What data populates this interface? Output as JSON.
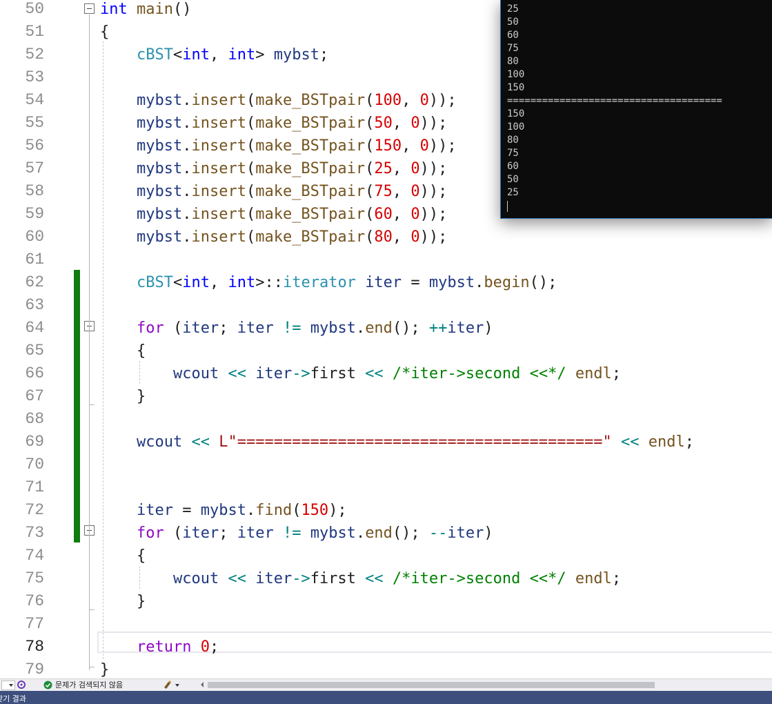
{
  "editor": {
    "line_numbers": [
      "50",
      "51",
      "52",
      "53",
      "54",
      "55",
      "56",
      "57",
      "58",
      "59",
      "60",
      "61",
      "62",
      "63",
      "64",
      "65",
      "66",
      "67",
      "68",
      "69",
      "70",
      "71",
      "72",
      "73",
      "74",
      "75",
      "76",
      "77",
      "78",
      "79"
    ],
    "current_line": "78",
    "lines": [
      [
        [
          "kw",
          "int"
        ],
        [
          "pun",
          " "
        ],
        [
          "fn",
          "main"
        ],
        [
          "pun",
          "()"
        ]
      ],
      [
        [
          "pun",
          "{"
        ]
      ],
      [
        [
          "pun",
          "    "
        ],
        [
          "cls",
          "cBST"
        ],
        [
          "pun",
          "<"
        ],
        [
          "kw",
          "int"
        ],
        [
          "pun",
          ", "
        ],
        [
          "kw",
          "int"
        ],
        [
          "pun",
          "> "
        ],
        [
          "var",
          "mybst"
        ],
        [
          "pun",
          ";"
        ]
      ],
      [],
      [
        [
          "pun",
          "    "
        ],
        [
          "var",
          "mybst"
        ],
        [
          "pun",
          "."
        ],
        [
          "fn",
          "insert"
        ],
        [
          "pun",
          "("
        ],
        [
          "fn",
          "make_BSTpair"
        ],
        [
          "pun",
          "("
        ],
        [
          "num",
          "100"
        ],
        [
          "pun",
          ", "
        ],
        [
          "num",
          "0"
        ],
        [
          "pun",
          "));"
        ]
      ],
      [
        [
          "pun",
          "    "
        ],
        [
          "var",
          "mybst"
        ],
        [
          "pun",
          "."
        ],
        [
          "fn",
          "insert"
        ],
        [
          "pun",
          "("
        ],
        [
          "fn",
          "make_BSTpair"
        ],
        [
          "pun",
          "("
        ],
        [
          "num",
          "50"
        ],
        [
          "pun",
          ", "
        ],
        [
          "num",
          "0"
        ],
        [
          "pun",
          "));"
        ]
      ],
      [
        [
          "pun",
          "    "
        ],
        [
          "var",
          "mybst"
        ],
        [
          "pun",
          "."
        ],
        [
          "fn",
          "insert"
        ],
        [
          "pun",
          "("
        ],
        [
          "fn",
          "make_BSTpair"
        ],
        [
          "pun",
          "("
        ],
        [
          "num",
          "150"
        ],
        [
          "pun",
          ", "
        ],
        [
          "num",
          "0"
        ],
        [
          "pun",
          "));"
        ]
      ],
      [
        [
          "pun",
          "    "
        ],
        [
          "var",
          "mybst"
        ],
        [
          "pun",
          "."
        ],
        [
          "fn",
          "insert"
        ],
        [
          "pun",
          "("
        ],
        [
          "fn",
          "make_BSTpair"
        ],
        [
          "pun",
          "("
        ],
        [
          "num",
          "25"
        ],
        [
          "pun",
          ", "
        ],
        [
          "num",
          "0"
        ],
        [
          "pun",
          "));"
        ]
      ],
      [
        [
          "pun",
          "    "
        ],
        [
          "var",
          "mybst"
        ],
        [
          "pun",
          "."
        ],
        [
          "fn",
          "insert"
        ],
        [
          "pun",
          "("
        ],
        [
          "fn",
          "make_BSTpair"
        ],
        [
          "pun",
          "("
        ],
        [
          "num",
          "75"
        ],
        [
          "pun",
          ", "
        ],
        [
          "num",
          "0"
        ],
        [
          "pun",
          "));"
        ]
      ],
      [
        [
          "pun",
          "    "
        ],
        [
          "var",
          "mybst"
        ],
        [
          "pun",
          "."
        ],
        [
          "fn",
          "insert"
        ],
        [
          "pun",
          "("
        ],
        [
          "fn",
          "make_BSTpair"
        ],
        [
          "pun",
          "("
        ],
        [
          "num",
          "60"
        ],
        [
          "pun",
          ", "
        ],
        [
          "num",
          "0"
        ],
        [
          "pun",
          "));"
        ]
      ],
      [
        [
          "pun",
          "    "
        ],
        [
          "var",
          "mybst"
        ],
        [
          "pun",
          "."
        ],
        [
          "fn",
          "insert"
        ],
        [
          "pun",
          "("
        ],
        [
          "fn",
          "make_BSTpair"
        ],
        [
          "pun",
          "("
        ],
        [
          "num",
          "80"
        ],
        [
          "pun",
          ", "
        ],
        [
          "num",
          "0"
        ],
        [
          "pun",
          "));"
        ]
      ],
      [],
      [
        [
          "pun",
          "    "
        ],
        [
          "cls",
          "cBST"
        ],
        [
          "pun",
          "<"
        ],
        [
          "kw",
          "int"
        ],
        [
          "pun",
          ", "
        ],
        [
          "kw",
          "int"
        ],
        [
          "pun",
          ">::"
        ],
        [
          "cls",
          "iterator"
        ],
        [
          "pun",
          " "
        ],
        [
          "var",
          "iter"
        ],
        [
          "pun",
          " = "
        ],
        [
          "var",
          "mybst"
        ],
        [
          "pun",
          "."
        ],
        [
          "fn",
          "begin"
        ],
        [
          "pun",
          "();"
        ]
      ],
      [],
      [
        [
          "pun",
          "    "
        ],
        [
          "ctl",
          "for"
        ],
        [
          "pun",
          " ("
        ],
        [
          "var",
          "iter"
        ],
        [
          "pun",
          "; "
        ],
        [
          "var",
          "iter"
        ],
        [
          "pun",
          " "
        ],
        [
          "op",
          "!="
        ],
        [
          "pun",
          " "
        ],
        [
          "var",
          "mybst"
        ],
        [
          "pun",
          "."
        ],
        [
          "fn",
          "end"
        ],
        [
          "pun",
          "(); "
        ],
        [
          "op",
          "++"
        ],
        [
          "var",
          "iter"
        ],
        [
          "pun",
          ")"
        ]
      ],
      [
        [
          "pun",
          "    {"
        ]
      ],
      [
        [
          "pun",
          "        "
        ],
        [
          "var",
          "wcout"
        ],
        [
          "pun",
          " "
        ],
        [
          "op",
          "<<"
        ],
        [
          "pun",
          " "
        ],
        [
          "var",
          "iter"
        ],
        [
          "op",
          "->"
        ],
        [
          "pun",
          "first "
        ],
        [
          "op",
          "<<"
        ],
        [
          "pun",
          " "
        ],
        [
          "cmt",
          "/*iter->second <<*/"
        ],
        [
          "pun",
          " "
        ],
        [
          "fn",
          "endl"
        ],
        [
          "pun",
          ";"
        ]
      ],
      [
        [
          "pun",
          "    }"
        ]
      ],
      [],
      [
        [
          "pun",
          "    "
        ],
        [
          "var",
          "wcout"
        ],
        [
          "pun",
          " "
        ],
        [
          "op",
          "<<"
        ],
        [
          "pun",
          " "
        ],
        [
          "str",
          "L\"========================================\""
        ],
        [
          "pun",
          " "
        ],
        [
          "op",
          "<<"
        ],
        [
          "pun",
          " "
        ],
        [
          "fn",
          "endl"
        ],
        [
          "pun",
          ";"
        ]
      ],
      [],
      [],
      [
        [
          "pun",
          "    "
        ],
        [
          "var",
          "iter"
        ],
        [
          "pun",
          " = "
        ],
        [
          "var",
          "mybst"
        ],
        [
          "pun",
          "."
        ],
        [
          "fn",
          "find"
        ],
        [
          "pun",
          "("
        ],
        [
          "num",
          "150"
        ],
        [
          "pun",
          ");"
        ]
      ],
      [
        [
          "pun",
          "    "
        ],
        [
          "ctl",
          "for"
        ],
        [
          "pun",
          " ("
        ],
        [
          "var",
          "iter"
        ],
        [
          "pun",
          "; "
        ],
        [
          "var",
          "iter"
        ],
        [
          "pun",
          " "
        ],
        [
          "op",
          "!="
        ],
        [
          "pun",
          " "
        ],
        [
          "var",
          "mybst"
        ],
        [
          "pun",
          "."
        ],
        [
          "fn",
          "end"
        ],
        [
          "pun",
          "(); "
        ],
        [
          "op",
          "--"
        ],
        [
          "var",
          "iter"
        ],
        [
          "pun",
          ")"
        ]
      ],
      [
        [
          "pun",
          "    {"
        ]
      ],
      [
        [
          "pun",
          "        "
        ],
        [
          "var",
          "wcout"
        ],
        [
          "pun",
          " "
        ],
        [
          "op",
          "<<"
        ],
        [
          "pun",
          " "
        ],
        [
          "var",
          "iter"
        ],
        [
          "op",
          "->"
        ],
        [
          "pun",
          "first "
        ],
        [
          "op",
          "<<"
        ],
        [
          "pun",
          " "
        ],
        [
          "cmt",
          "/*iter->second <<*/"
        ],
        [
          "pun",
          " "
        ],
        [
          "fn",
          "endl"
        ],
        [
          "pun",
          ";"
        ]
      ],
      [
        [
          "pun",
          "    }"
        ]
      ],
      [],
      [
        [
          "pun",
          "    "
        ],
        [
          "ctl",
          "return"
        ],
        [
          "pun",
          " "
        ],
        [
          "num",
          "0"
        ],
        [
          "pun",
          ";"
        ]
      ],
      [
        [
          "pun",
          "}"
        ]
      ]
    ]
  },
  "console": {
    "lines": [
      "25",
      "50",
      "60",
      "75",
      "80",
      "100",
      "150",
      "=====================================",
      "150",
      "100",
      "80",
      "75",
      "60",
      "50",
      "25"
    ]
  },
  "statusbar": {
    "issues_text": "문제가 검색되지 않음"
  },
  "titlebar": {
    "text": "찾기 결과"
  },
  "colors": {
    "change_bar": "#107c10",
    "console_bg": "#0c0c0c",
    "title_bar": "#3c4f7d"
  }
}
